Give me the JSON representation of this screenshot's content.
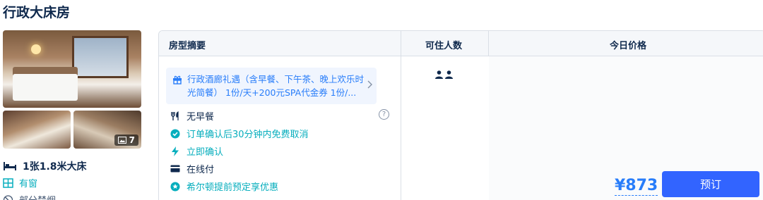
{
  "room": {
    "title": "行政大床房",
    "photo_count": "7",
    "bed": "1张1.8米大床",
    "window": "有窗",
    "smoking": "部分禁烟"
  },
  "table": {
    "headers": {
      "summary": "房型摘要",
      "occupancy": "可住人数",
      "price": "今日价格"
    }
  },
  "offer": {
    "promo": "行政酒廊礼遇（含早餐、下午茶、晚上欢乐时光简餐） 1份/天+200元SPA代金券 1份/...",
    "policies": [
      {
        "label": "无早餐",
        "icon": "fork-knife-icon"
      },
      {
        "label": "订单确认后30分钟内免费取消",
        "icon": "check-circle-icon"
      },
      {
        "label": "立即确认",
        "icon": "lightning-icon"
      },
      {
        "label": "在线付",
        "icon": "card-icon"
      },
      {
        "label": "希尔顿提前预定享优惠",
        "icon": "star-badge-icon"
      }
    ],
    "guests": 2,
    "price": "¥873",
    "book_label": "预订"
  },
  "colors": {
    "accent": "#287dfa",
    "green": "#06aebd",
    "button": "#3264ff",
    "text": "#0f294d"
  }
}
